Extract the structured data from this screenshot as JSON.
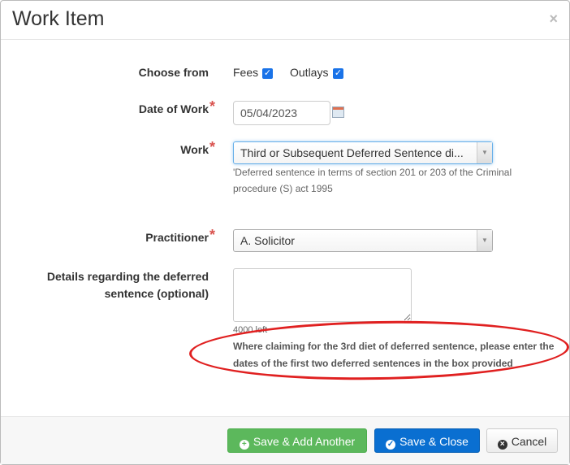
{
  "header": {
    "title": "Work Item",
    "close_label": "×"
  },
  "form": {
    "choose_from": {
      "label": "Choose from",
      "fees_label": "Fees",
      "fees_checked": true,
      "outlays_label": "Outlays",
      "outlays_checked": true
    },
    "date_of_work": {
      "label": "Date of Work",
      "required_mark": "*",
      "value": "05/04/2023",
      "icon": "calendar-icon"
    },
    "work": {
      "label": "Work",
      "required_mark": "*",
      "value": "Third or Subsequent Deferred Sentence di...",
      "help": "'Deferred sentence in terms of section 201 or 203 of the Criminal procedure (S) act 1995"
    },
    "practitioner": {
      "label": "Practitioner",
      "required_mark": "*",
      "value": "A. Solicitor"
    },
    "details": {
      "label": "Details regarding the deferred sentence (optional)",
      "value": "",
      "counter": "4000 left",
      "note": "Where claiming for the 3rd diet of deferred sentence, please enter the dates of the first two deferred sentences in the box provided"
    }
  },
  "annotation": {
    "color": "#e02020",
    "shape": "ellipse"
  },
  "footer": {
    "save_add": {
      "label": "Save & Add Another",
      "color": "#5cb85c"
    },
    "save_close": {
      "label": "Save & Close",
      "color": "#0a6fd1"
    },
    "cancel": {
      "label": "Cancel"
    }
  }
}
